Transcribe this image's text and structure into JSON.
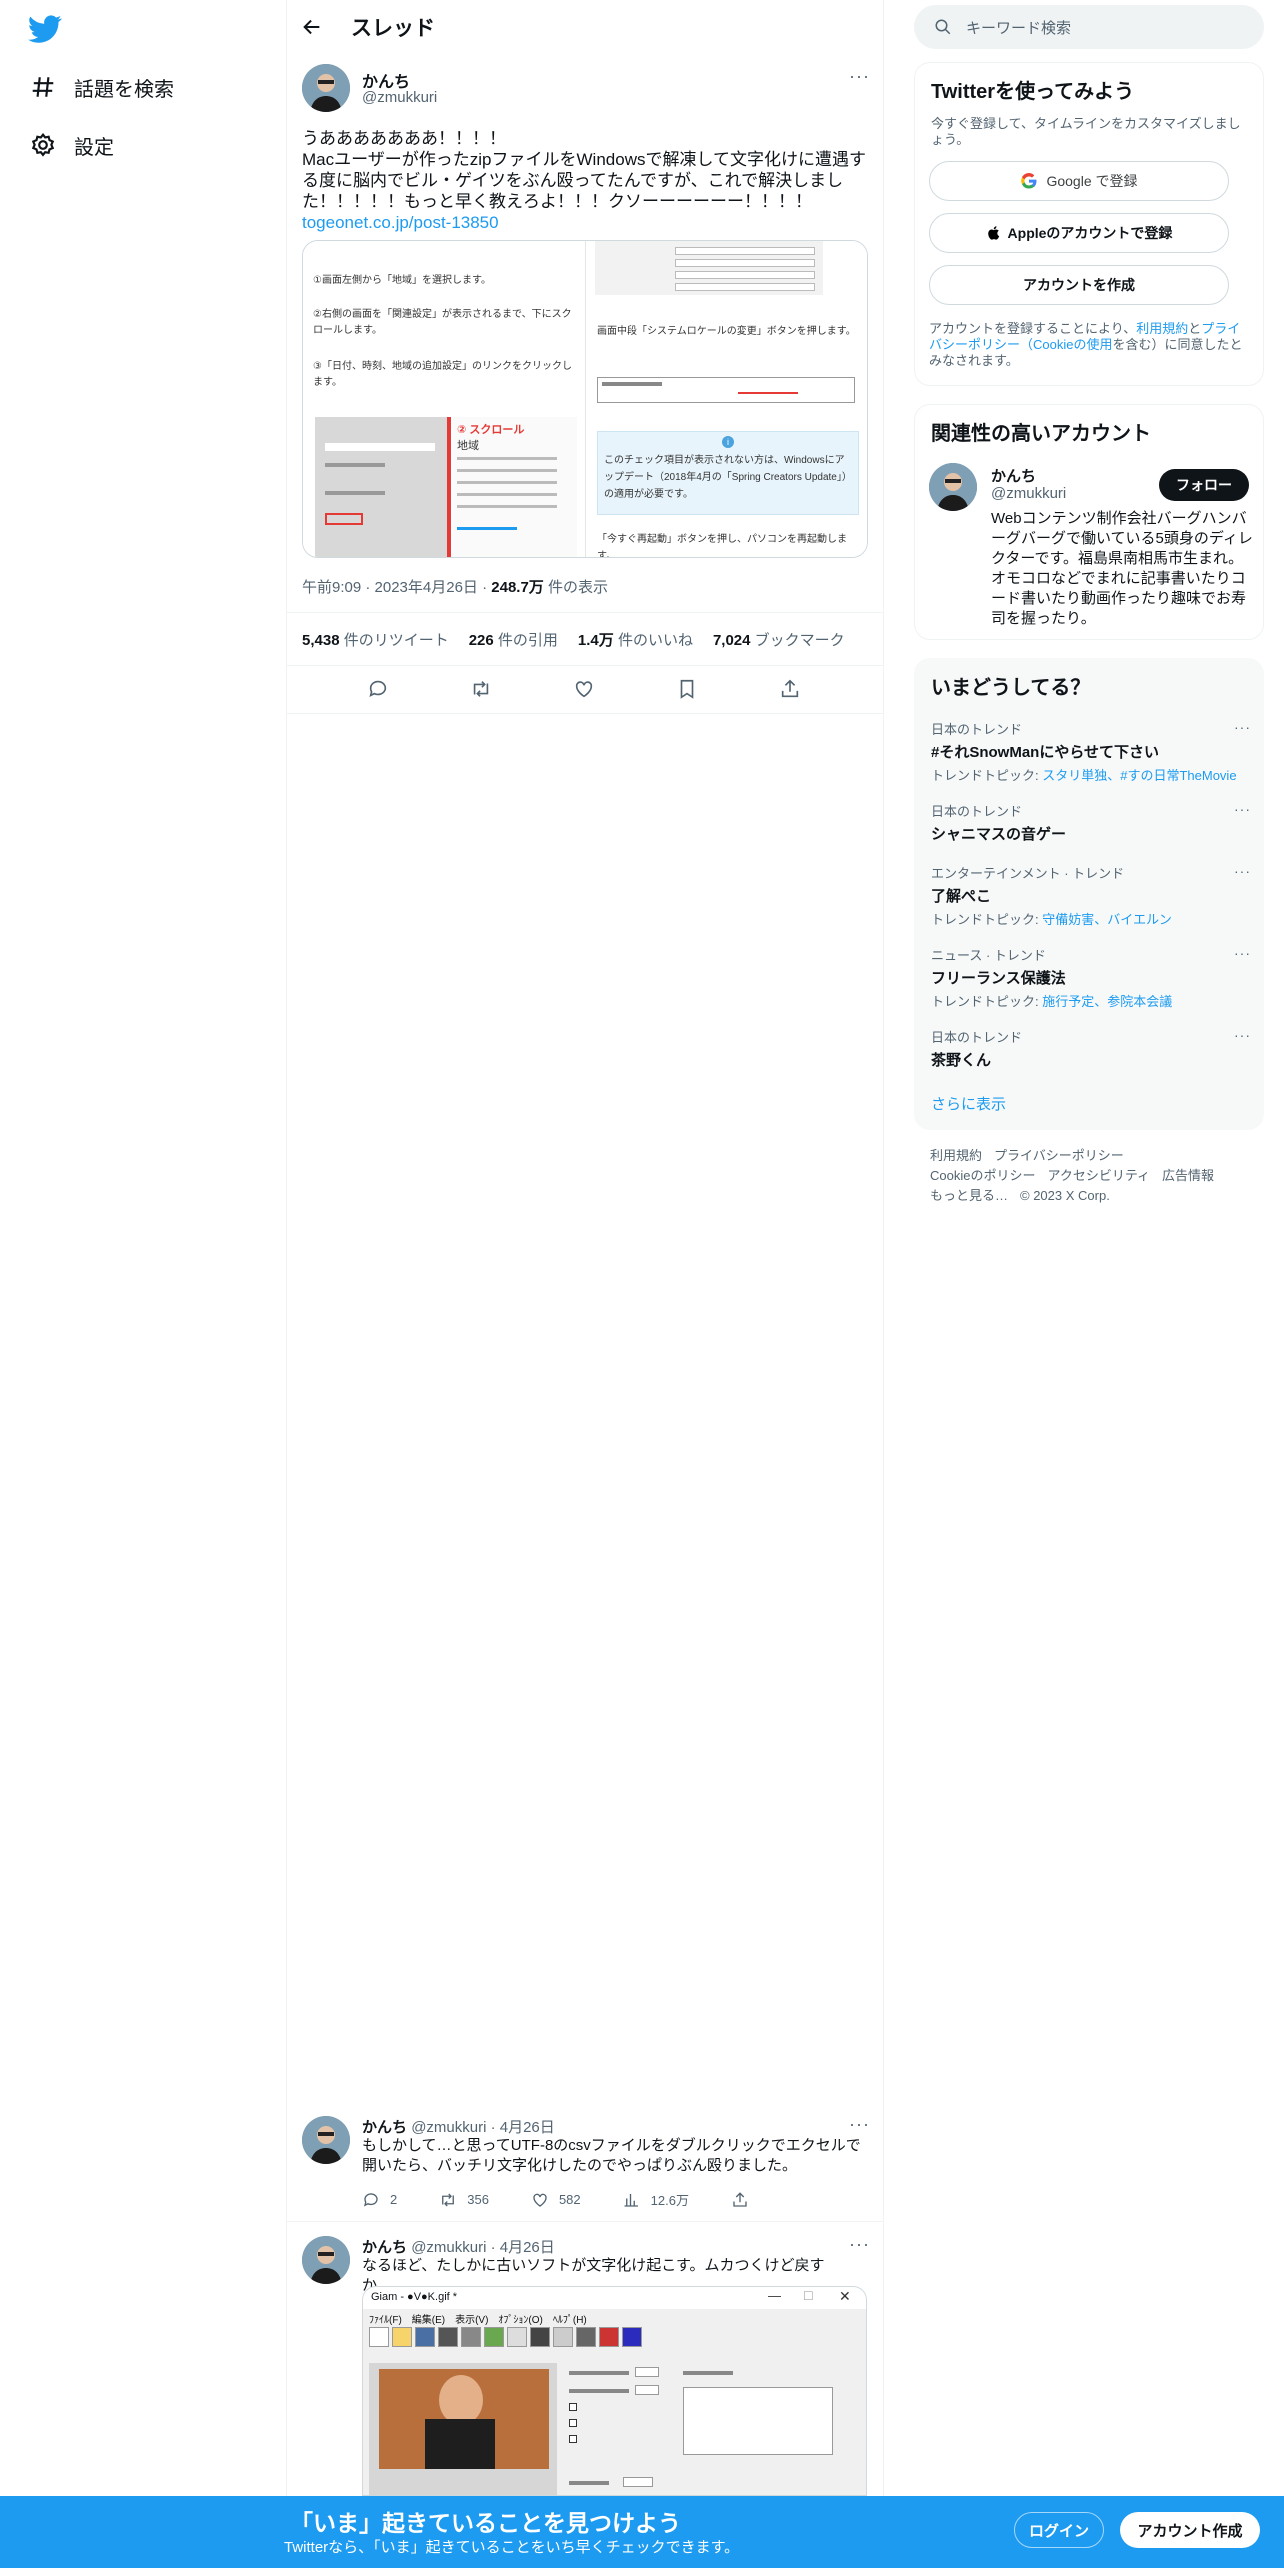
{
  "nav": {
    "items": [
      {
        "label": "話題を検索",
        "icon": "hashtag-icon"
      },
      {
        "label": "設定",
        "icon": "gear-icon"
      }
    ]
  },
  "header": {
    "title": "スレッド"
  },
  "main_tweet": {
    "name": "かんち",
    "handle": "@zmukkuri",
    "text_line1": "うあああああああ！！！！",
    "text_body": "Macユーザーが作ったzipファイルをWindowsで解凍して文字化けに遭遇する度に脳内でビル・ゲイツをぶん殴ってたんですが、これで解決しました！！！！！もっと早く教えろよ！！！クソーーーーーー！！！！",
    "link": "togeonet.co.jp/post-13850",
    "time": "午前9:09 · 2023年4月26日 · ",
    "views_num": "248.7万",
    "views_label": " 件の表示",
    "stats": {
      "retweets_num": "5,438",
      "retweets_label": " 件のリツイート",
      "quotes_num": "226",
      "quotes_label": " 件の引用",
      "likes_num": "1.4万",
      "likes_label": " 件のいいね",
      "bookmarks_num": "7,024",
      "bookmarks_label": " ブックマーク"
    }
  },
  "media": {
    "left_step1": "①画面左側から「地域」を選択します。",
    "left_step2": "②右側の画面を「関連設定」が表示されるまで、下にスクロールします。",
    "left_step3": "③「日付、時刻、地域の追加設定」のリンクをクリックします。",
    "scroll_label": "② スクロール",
    "region_label": "地域",
    "right_text1": "画面中段「システムロケールの変更」ボタンを押します。",
    "right_note": "このチェック項目が表示されない方は、Windowsにアップデート（2018年4月の「Spring Creators Update」）の適用が必要です。",
    "right_text2": "「今すぐ再起動」ボタンを押し、パソコンを再起動します。"
  },
  "replies": [
    {
      "name": "かんち",
      "handle": "@zmukkuri · 4月26日",
      "text": "もしかして…と思ってUTF-8のcsvファイルをダブルクリックでエクセルで開いたら、バッチリ文字化けしたのでやっぱりぶん殴りました。",
      "replies": "2",
      "retweets": "356",
      "likes": "582",
      "views": "12.6万"
    },
    {
      "name": "かんち",
      "handle": "@zmukkuri · 4月26日",
      "text": "なるほど、たしかに古いソフトが文字化け起こす。ムカつくけど戻すか……",
      "window_title": "Giam - ●V●K.gif *",
      "menu": "ﾌｧｲﾙ(F)　編集(E)　表示(V)　ｵﾌﾟｼｮﾝ(O)　ﾍﾙﾌﾟ(H)"
    }
  ],
  "search": {
    "placeholder": "キーワード検索"
  },
  "signup_card": {
    "title": "Twitterを使ってみよう",
    "subtitle": "今すぐ登録して、タイムラインをカスタマイズしましょう。",
    "google": "Google で登録",
    "apple": "Appleのアカウントで登録",
    "create": "アカウントを作成",
    "legal_pre": "アカウントを登録することにより、",
    "legal_terms": "利用規約",
    "legal_and": "と",
    "legal_privacy": "プライバシーポリシー（Cookieの使用",
    "legal_post": "を含む）に同意したとみなされます。"
  },
  "related": {
    "title": "関連性の高いアカウント",
    "name": "かんち",
    "handle": "@zmukkuri",
    "follow": "フォロー",
    "bio": "Webコンテンツ制作会社バーグハンバーグバーグで働いている5頭身のディレクターです。福島県南相馬市生まれ。オモコロなどでまれに記事書いたりコード書いたり動画作ったり趣味でお寿司を握ったり。"
  },
  "trends": {
    "title": "いまどうしてる？",
    "items": [
      {
        "cat": "日本のトレンド",
        "title": "#それSnowManにやらせて下さい",
        "topic_label": "トレンドトピック: ",
        "topic": "スタリ単独、#すの日常TheMovie"
      },
      {
        "cat": "日本のトレンド",
        "title": "シャニマスの音ゲー",
        "topic_label": "",
        "topic": ""
      },
      {
        "cat": "エンターテインメント · トレンド",
        "title": "了解ぺこ",
        "topic_label": "トレンドトピック: ",
        "topic": "守備妨害、バイエルン"
      },
      {
        "cat": "ニュース · トレンド",
        "title": "フリーランス保護法",
        "topic_label": "トレンドトピック: ",
        "topic": "施行予定、参院本会議"
      },
      {
        "cat": "日本のトレンド",
        "title": "茶野くん",
        "topic_label": "",
        "topic": ""
      }
    ],
    "show_more": "さらに表示"
  },
  "footer": {
    "terms": "利用規約",
    "privacy": "プライバシーポリシー",
    "cookie": "Cookieのポリシー",
    "accessibility": "アクセシビリティ",
    "ads": "広告情報",
    "more": "もっと見る…",
    "copyright": "© 2023 X Corp."
  },
  "bottom": {
    "title": "「いま」起きていることを見つけよう",
    "subtitle": "Twitterなら、「いま」起きていることをいち早くチェックできます。",
    "login": "ログイン",
    "signup": "アカウント作成"
  },
  "colors": {
    "accent": "#1d9bf0",
    "text": "#0f1419",
    "secondary": "#536471"
  }
}
